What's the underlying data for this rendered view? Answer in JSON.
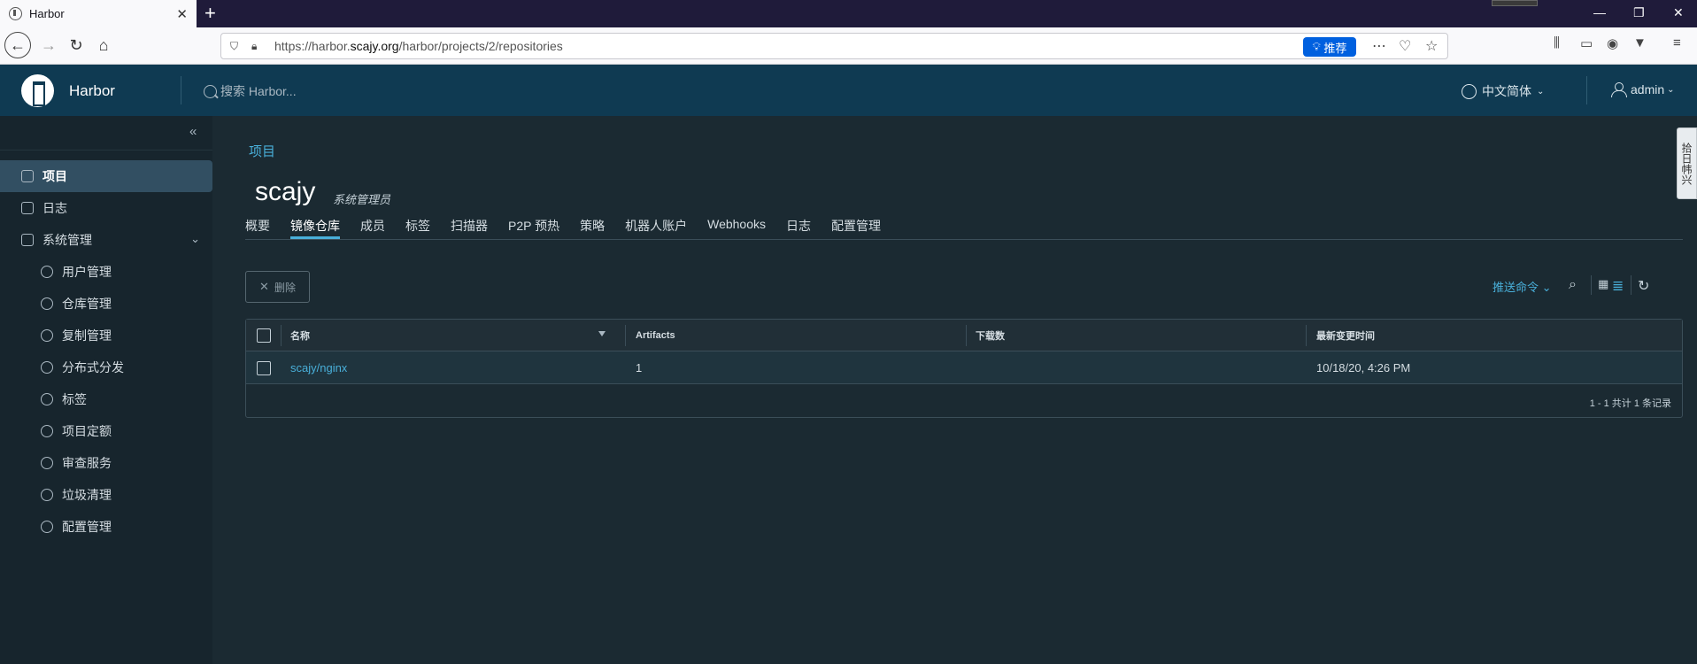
{
  "browser": {
    "tab_title": "Harbor",
    "url_prefix": "https://harbor.",
    "url_domain": "scajy.org",
    "url_path": "/harbor/projects/2/repositories",
    "recommend_label": "推荐"
  },
  "header": {
    "brand": "Harbor",
    "search_placeholder": "搜索 Harbor...",
    "language": "中文简体",
    "user": "admin"
  },
  "sidebar": {
    "items": [
      {
        "label": "项目"
      },
      {
        "label": "日志"
      },
      {
        "label": "系统管理"
      },
      {
        "label": "用户管理"
      },
      {
        "label": "仓库管理"
      },
      {
        "label": "复制管理"
      },
      {
        "label": "分布式分发"
      },
      {
        "label": "标签"
      },
      {
        "label": "项目定额"
      },
      {
        "label": "审查服务"
      },
      {
        "label": "垃圾清理"
      },
      {
        "label": "配置管理"
      }
    ]
  },
  "main": {
    "breadcrumb": "项目",
    "project_name": "scajy",
    "project_role": "系统管理员",
    "tabs": [
      {
        "label": "概要"
      },
      {
        "label": "镜像仓库"
      },
      {
        "label": "成员"
      },
      {
        "label": "标签"
      },
      {
        "label": "扫描器"
      },
      {
        "label": "P2P 预热"
      },
      {
        "label": "策略"
      },
      {
        "label": "机器人账户"
      },
      {
        "label": "Webhooks"
      },
      {
        "label": "日志"
      },
      {
        "label": "配置管理"
      }
    ],
    "delete_label": "删除",
    "push_command": "推送命令",
    "table": {
      "columns": [
        "名称",
        "Artifacts",
        "下载数",
        "最新变更时间"
      ],
      "rows": [
        {
          "name": "scajy/nginx",
          "artifacts": "1",
          "downloads": "",
          "updated": "10/18/20, 4:26 PM"
        }
      ],
      "footer": "1 - 1 共计 1 条记录"
    }
  },
  "drawer_label": "拾日帏兴"
}
